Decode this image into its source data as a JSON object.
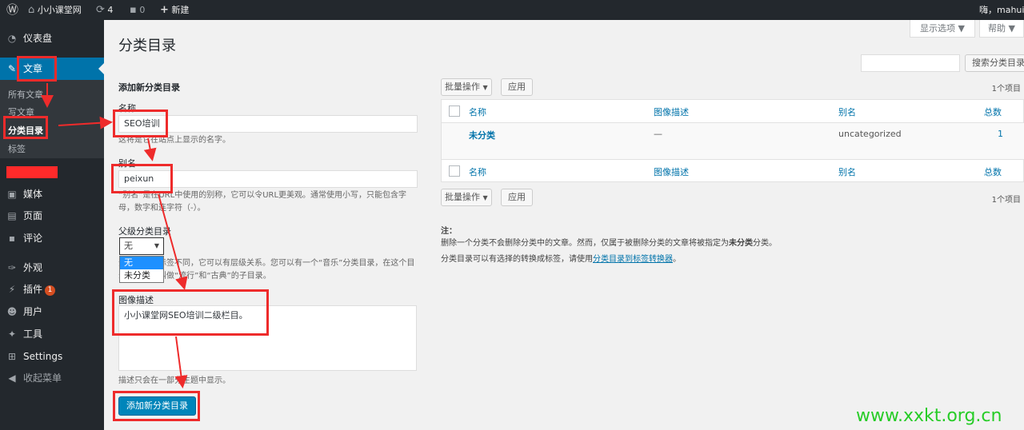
{
  "adminbar": {
    "wp_icon": "wordpress-icon",
    "site_name": "小小课堂网",
    "updates_count": "4",
    "comments_count": "0",
    "new_label": "新建",
    "greeting": "嗨，mahui"
  },
  "sidebar": {
    "dashboard": "仪表盘",
    "posts": "文章",
    "sub": {
      "all_posts": "所有文章",
      "write_post": "写文章",
      "categories": "分类目录",
      "tags": "标签"
    },
    "media": "媒体",
    "pages": "页面",
    "comments": "评论",
    "appearance": "外观",
    "plugins": "插件",
    "plugins_badge": "1",
    "users": "用户",
    "tools": "工具",
    "settings": "Settings",
    "collapse": "收起菜单"
  },
  "screen_options": "显示选项 ▼",
  "help": "帮助 ▼",
  "page_title": "分类目录",
  "search_button": "搜索分类目录",
  "form": {
    "heading": "添加新分类目录",
    "name_label": "名称",
    "name_value": "SEO培训",
    "name_help": "这将是它在站点上显示的名字。",
    "slug_label": "别名",
    "slug_value": "peixun",
    "slug_help_1": "“别名”是在URL中使用的别称，它可以令URL更美观。通常使用小写，只能包含字",
    "slug_help_2": "母，数字和连字符（-）。",
    "parent_label": "父级分类目录",
    "parent_value": "无",
    "parent_options": [
      "无",
      "未分类"
    ],
    "parent_help_1": "分类目录和标签不同，它可以有层级关系。您可以有一个“音乐”分类目录，在这个目",
    "parent_help_2": "录下可以有叫做“流行”和“古典”的子目录。",
    "desc_label": "图像描述",
    "desc_value": "小小课堂网SEO培训二级栏目。",
    "desc_help": "描述只会在一部分主题中显示。",
    "submit": "添加新分类目录"
  },
  "list": {
    "bulk_action": "批量操作",
    "apply": "应用",
    "items_count": "1个项目",
    "columns": [
      "名称",
      "图像描述",
      "别名",
      "总数"
    ],
    "rows": [
      {
        "name": "未分类",
        "description": "—",
        "slug": "uncategorized",
        "count": "1"
      }
    ]
  },
  "notes": {
    "title": "注：",
    "line1_a": "删除一个分类不会删除分类中的文章。然而，仅属于被删除分类的文章将被指定为",
    "line1_b": "未分类",
    "line1_c": "分类。",
    "line2_a": "分类目录可以有选择的转换成标签，请使用",
    "line2_link": "分类目录到标签转换器",
    "line2_c": "。"
  },
  "watermark": "www.xxkt.org.cn",
  "colors": {
    "accent": "#0073aa",
    "annotation": "#ee2b2b",
    "watermark": "#27cc27"
  }
}
